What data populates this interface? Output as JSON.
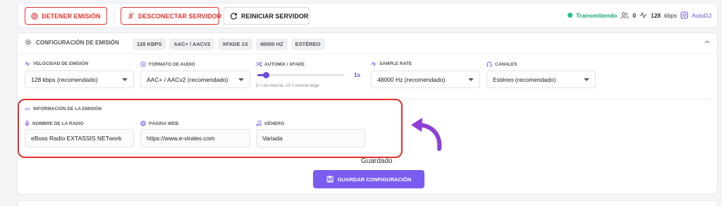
{
  "toolbar": {
    "stop_label": "DETENER EMISIÓN",
    "disconnect_label": "DESCONECTAR SERVIDOR",
    "restart_label": "REINICIAR SERVIDOR",
    "status_text": "Transmitiendo",
    "listeners": "0",
    "bitrate": "128",
    "bitrate_unit": "kbps",
    "autodj_label": "AutoDJ"
  },
  "config": {
    "title": "CONFIGURACIÓN DE EMISIÓN",
    "badges": [
      "128 KBPS",
      "AAC+ / AACV2",
      "XFADE 1S",
      "48000 HZ",
      "ESTÉREO"
    ],
    "fields": {
      "bitrate_label": "VELOCIDAD DE EMISIÓN",
      "bitrate_value": "128 kbps (recomendado)",
      "format_label": "FORMATO DE AUDIO",
      "format_value": "AAC+ / AACv2 (recomendado)",
      "xfade_label": "AUTOMIX / XFADE",
      "xfade_value": "1s",
      "xfade_level": 0.1,
      "xfade_hint": "0 = sin mezcla, 10 = mezcla larga",
      "samplerate_label": "SAMPLE RATE",
      "samplerate_value": "48000 Hz (recomendado)",
      "channels_label": "CANALES",
      "channels_value": "Estéreo (recomendado)"
    }
  },
  "info": {
    "title": "INFORMACIÓN DE LA EMISIÓN",
    "name_label": "NOMBRE DE LA RADIO",
    "name_value": "eBoss Radio EXTASSIS NETwork",
    "web_label": "PÁGINA WEB",
    "web_value": "https://www.e-virales.com",
    "genre_label": "GÉNERO",
    "genre_value": "Variada"
  },
  "footer": {
    "saved_text": "Guardado",
    "save_label": "GUARDAR CONFIGURACIÓN"
  },
  "colors": {
    "danger": "#e3342f",
    "accent": "#7b5cf0",
    "success": "#20c08a"
  }
}
